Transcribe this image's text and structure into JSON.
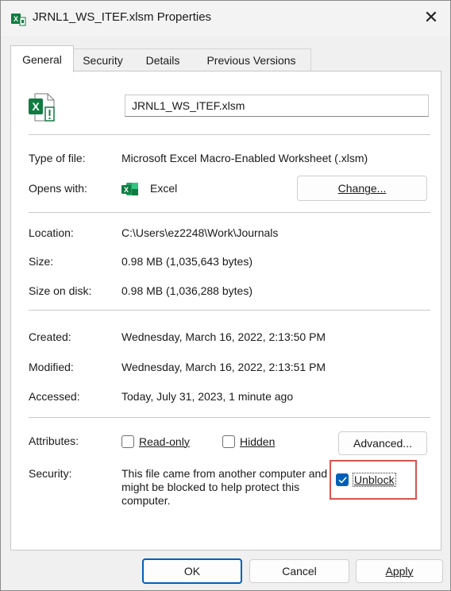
{
  "window": {
    "title": "JRNL1_WS_ITEF.xlsm Properties",
    "close_symbol": "✕"
  },
  "tabs": [
    {
      "label": "General",
      "active": true
    },
    {
      "label": "Security",
      "active": false
    },
    {
      "label": "Details",
      "active": false
    },
    {
      "label": "Previous Versions",
      "active": false
    }
  ],
  "general": {
    "file_name": "JRNL1_WS_ITEF.xlsm",
    "file_icon": "excel-macro-file-icon",
    "type_label": "Type of file:",
    "type_value": "Microsoft Excel Macro-Enabled Worksheet (.xlsm)",
    "opens_label": "Opens with:",
    "opens_value": "Excel",
    "opens_icon": "excel-icon",
    "change_button": "Change...",
    "location_label": "Location:",
    "location_value": "C:\\Users\\ez2248\\Work\\Journals",
    "size_label": "Size:",
    "size_value": "0.98 MB (1,035,643 bytes)",
    "size_on_disk_label": "Size on disk:",
    "size_on_disk_value": "0.98 MB (1,036,288 bytes)",
    "created_label": "Created:",
    "created_value": "Wednesday, March 16, 2022, 2:13:50 PM",
    "modified_label": "Modified:",
    "modified_value": "Wednesday, March 16, 2022, 2:13:51 PM",
    "accessed_label": "Accessed:",
    "accessed_value": "Today, July 31, 2023, 1 minute ago",
    "attributes_label": "Attributes:",
    "readonly_label": "Read-only",
    "readonly_checked": false,
    "hidden_label": "Hidden",
    "hidden_checked": false,
    "advanced_button": "Advanced...",
    "security_label": "Security:",
    "security_text": "This file came from another computer and might be blocked to help protect this computer.",
    "unblock_label": "Unblock",
    "unblock_checked": true
  },
  "footer": {
    "ok": "OK",
    "cancel": "Cancel",
    "apply": "Apply"
  },
  "colors": {
    "accent": "#005fb8",
    "excel_green": "#107c41",
    "highlight_red": "#d9534f"
  }
}
